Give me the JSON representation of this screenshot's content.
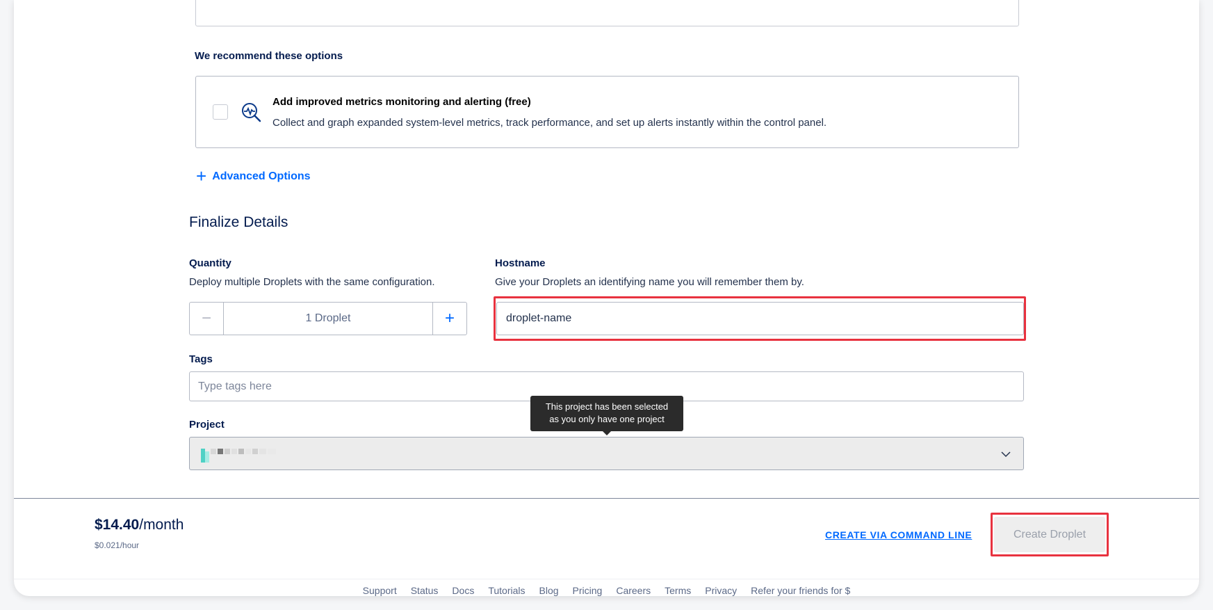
{
  "recommend": {
    "label": "We recommend these options",
    "option_title": "Add improved metrics monitoring and alerting (free)",
    "option_desc": "Collect and graph expanded system-level metrics, track performance, and set up alerts instantly within the control panel."
  },
  "advanced": {
    "plus": "+",
    "label": "Advanced Options"
  },
  "finalize": {
    "title": "Finalize Details",
    "quantity_label": "Quantity",
    "quantity_desc": "Deploy multiple Droplets with the same configuration.",
    "quantity_value": "1  Droplet",
    "minus": "−",
    "plus": "+",
    "hostname_label": "Hostname",
    "hostname_desc": "Give your Droplets an identifying name you will remember them by.",
    "hostname_value": "droplet-name",
    "tags_label": "Tags",
    "tags_placeholder": "Type tags here",
    "project_label": "Project",
    "tooltip_line1": "This project has been selected",
    "tooltip_line2": "as you only have one project"
  },
  "footer": {
    "price_amount": "$14.40",
    "price_period": "/month",
    "price_hour": "$0.021/hour",
    "cli_link": "CREATE VIA COMMAND LINE",
    "create_button": "Create Droplet"
  },
  "links": [
    "Support",
    "Status",
    "Docs",
    "Tutorials",
    "Blog",
    "Pricing",
    "Careers",
    "Terms",
    "Privacy",
    "Refer your friends for $"
  ],
  "colors": {
    "accent": "#0069ff",
    "highlight": "#e8323f",
    "text": "#031b4e"
  }
}
